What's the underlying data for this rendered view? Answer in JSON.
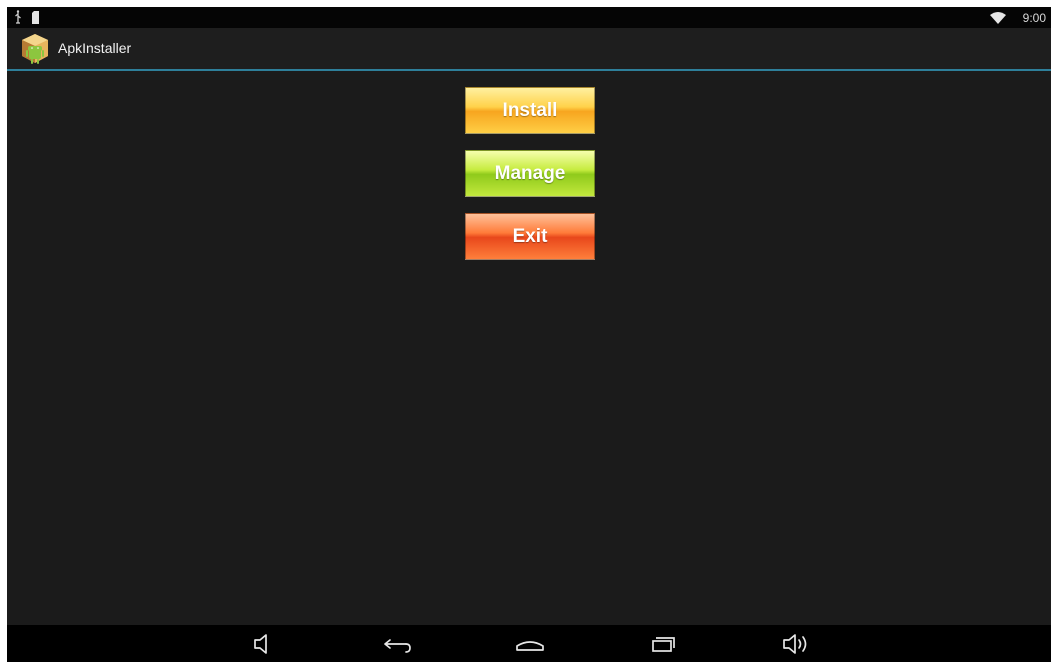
{
  "status_bar": {
    "left_icons": [
      "usb-icon",
      "sd-card-icon"
    ],
    "right_icons": [
      "wifi-icon"
    ],
    "time": "9:00"
  },
  "app": {
    "title": "ApkInstaller",
    "icon": "apk-package-icon"
  },
  "buttons": {
    "install": "Install",
    "manage": "Manage",
    "exit": "Exit"
  },
  "nav_bar": {
    "icons": [
      "volume-down-icon",
      "back-icon",
      "home-icon",
      "recent-apps-icon",
      "volume-up-icon"
    ]
  },
  "colors": {
    "background": "#1b1b1b",
    "action_bar_border": "#2e7f9a",
    "install": "#ffc83d",
    "manage": "#b5df35",
    "exit": "#f46a2d"
  }
}
